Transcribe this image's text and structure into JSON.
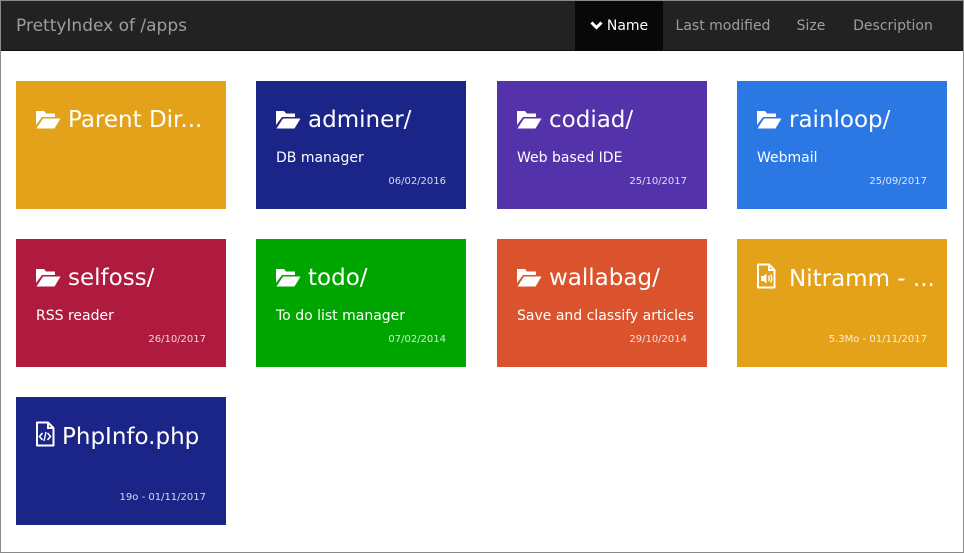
{
  "brand": "PrettyIndex of /apps",
  "sort_menu": {
    "name": "Name",
    "last_modified": "Last modified",
    "size": "Size",
    "description": "Description"
  },
  "tiles": [
    {
      "title": "Parent Dir...",
      "description": "",
      "meta": "",
      "icon": "folder-open-icon",
      "color": "#e3a21a"
    },
    {
      "title": "adminer/",
      "description": "DB manager",
      "meta": "06/02/2016",
      "icon": "folder-open-icon",
      "color": "#1b2587"
    },
    {
      "title": "codiad/",
      "description": "Web based IDE",
      "meta": "25/10/2017",
      "icon": "folder-open-icon",
      "color": "#5433aa"
    },
    {
      "title": "rainloop/",
      "description": "Webmail",
      "meta": "25/09/2017",
      "icon": "folder-open-icon",
      "color": "#2b78e4"
    },
    {
      "title": "selfoss/",
      "description": "RSS reader",
      "meta": "26/10/2017",
      "icon": "folder-open-icon",
      "color": "#ae1b3f"
    },
    {
      "title": "todo/",
      "description": "To do list manager",
      "meta": "07/02/2014",
      "icon": "folder-open-icon",
      "color": "#00a600"
    },
    {
      "title": "wallabag/",
      "description": "Save and classify articles",
      "meta": "29/10/2014",
      "icon": "folder-open-icon",
      "color": "#da532c"
    },
    {
      "title": "Nitramm - ...",
      "description": "",
      "meta": "5.3Mo - 01/11/2017",
      "icon": "audio-file-icon",
      "color": "#e3a21a"
    },
    {
      "title": "PhpInfo.php",
      "description": "",
      "meta": "19o - 01/11/2017",
      "icon": "code-file-icon",
      "color": "#1b2587"
    }
  ]
}
